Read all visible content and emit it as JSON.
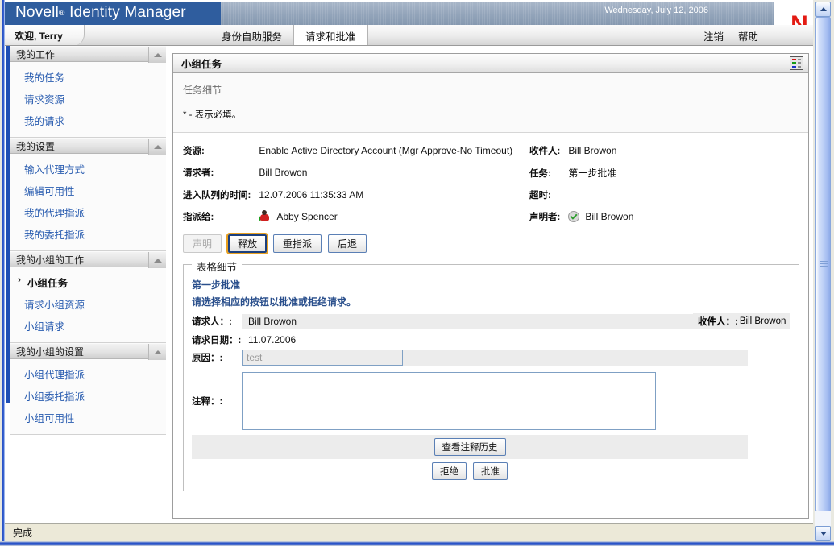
{
  "window": {
    "brand_name": "Novell",
    "brand_reg": "®",
    "brand_product": "Identity Manager",
    "date": "Wednesday, July 12, 2006",
    "logo_letter": "N",
    "status_text": "完成"
  },
  "navbar": {
    "welcome": "欢迎, Terry",
    "tabs": [
      {
        "label": "身份自助服务",
        "active": false
      },
      {
        "label": "请求和批准",
        "active": true
      }
    ],
    "logout": "注销",
    "help": "帮助"
  },
  "sidebar": {
    "sections": [
      {
        "title": "我的工作",
        "items": [
          {
            "label": "我的任务",
            "current": false
          },
          {
            "label": "请求资源",
            "current": false
          },
          {
            "label": "我的请求",
            "current": false
          }
        ]
      },
      {
        "title": "我的设置",
        "items": [
          {
            "label": "输入代理方式",
            "current": false
          },
          {
            "label": "编辑可用性",
            "current": false
          },
          {
            "label": "我的代理指派",
            "current": false
          },
          {
            "label": "我的委托指派",
            "current": false
          }
        ]
      },
      {
        "title": "我的小组的工作",
        "items": [
          {
            "label": "小组任务",
            "current": true
          },
          {
            "label": "请求小组资源",
            "current": false
          },
          {
            "label": "小组请求",
            "current": false
          }
        ]
      },
      {
        "title": "我的小组的设置",
        "items": [
          {
            "label": "小组代理指派",
            "current": false
          },
          {
            "label": "小组委托指派",
            "current": false
          },
          {
            "label": "小组可用性",
            "current": false
          }
        ]
      }
    ]
  },
  "panel": {
    "title": "小组任务",
    "subtitle": "任务细节",
    "required_note": "* - 表示必填。"
  },
  "task_details": {
    "left": [
      {
        "label": "资源:",
        "value": "Enable Active Directory Account (Mgr Approve-No Timeout)"
      },
      {
        "label": "请求者:",
        "value": "Bill Browon"
      },
      {
        "label": "进入队列的时间:",
        "value": "12.07.2006 11:35:33 AM"
      },
      {
        "label": "指派给:",
        "value": "Abby Spencer"
      }
    ],
    "right": [
      {
        "label": "收件人:",
        "value": "Bill Browon"
      },
      {
        "label": "任务:",
        "value": "第一步批准"
      },
      {
        "label": "超时:",
        "value": ""
      },
      {
        "label": "声明者:",
        "value": "Bill Browon"
      }
    ]
  },
  "action_buttons": [
    {
      "label": "声明",
      "state": "disabled"
    },
    {
      "label": "释放",
      "state": "focused"
    },
    {
      "label": "重指派",
      "state": "normal"
    },
    {
      "label": "后退",
      "state": "normal"
    }
  ],
  "form": {
    "legend": "表格细节",
    "heading": "第一步批准",
    "instruction": "请选择相应的按钮以批准或拒绝请求。",
    "requester_label": "请求人：:",
    "requester_value": "Bill Browon",
    "recipient_label": "收件人：:",
    "recipient_value": "Bill Browon",
    "date_label": "请求日期：:",
    "date_value": "11.07.2006",
    "reason_label": "原因：:",
    "reason_value": "test",
    "comment_label": "注释：:",
    "comment_value": "",
    "history_button": "查看注释历史",
    "deny_button": "拒绝",
    "approve_button": "批准"
  },
  "colors": {
    "brand_blue": "#2f5d9e",
    "logo_red": "#e31b13",
    "link_blue": "#2a5db0",
    "form_heading": "#2a4f8c",
    "focus_orange": "#e8a020"
  }
}
